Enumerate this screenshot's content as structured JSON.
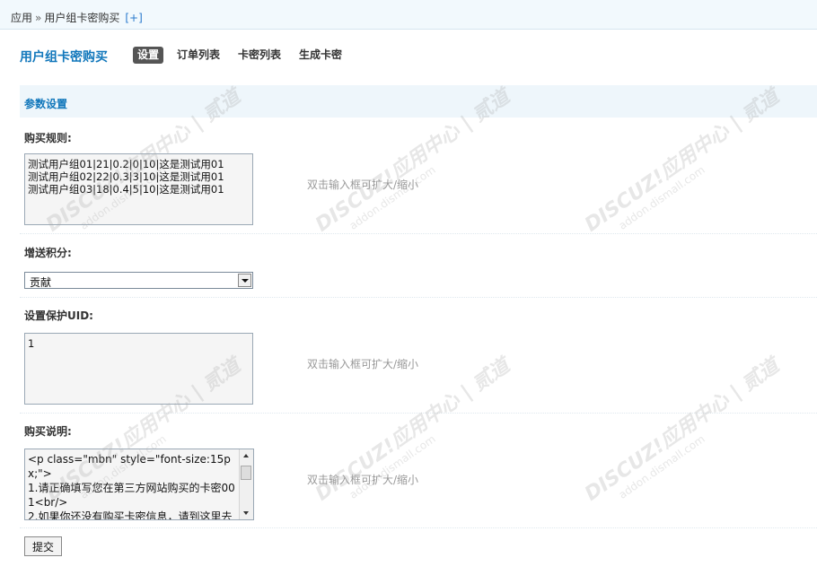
{
  "breadcrumb": {
    "root": "应用",
    "sep": "»",
    "current": "用户组卡密购买",
    "plus": "[+]"
  },
  "page_title": "用户组卡密购买",
  "tabs": [
    {
      "label": "设置",
      "active": true
    },
    {
      "label": "订单列表",
      "active": false
    },
    {
      "label": "卡密列表",
      "active": false
    },
    {
      "label": "生成卡密",
      "active": false
    }
  ],
  "section_title": "参数设置",
  "fields": {
    "rules": {
      "label": "购买规则:",
      "value": "测试用户组01|21|0.2|0|10|这是测试用01\n测试用户组02|22|0.3|3|10|这是测试用01\n测试用户组03|18|0.4|5|10|这是测试用01",
      "hint": "双击输入框可扩大/缩小"
    },
    "credit": {
      "label": "增送积分:",
      "selected": "贡献"
    },
    "protect_uid": {
      "label": "设置保护UID:",
      "value": "1",
      "hint": "双击输入框可扩大/缩小"
    },
    "description": {
      "label": "购买说明:",
      "value": "<p class=\"mbn\" style=\"font-size:15px;\">\n1.请正确填写您在第三方网站购买的卡密001<br/>\n2.如果你还没有购买卡密信息，请到这里去",
      "hint": "双击输入框可扩大/缩小"
    }
  },
  "submit_label": "提交",
  "watermark": {
    "brand": "DISCUZ!应用中心 | 贰道",
    "domain": "addon.dismall.com"
  }
}
